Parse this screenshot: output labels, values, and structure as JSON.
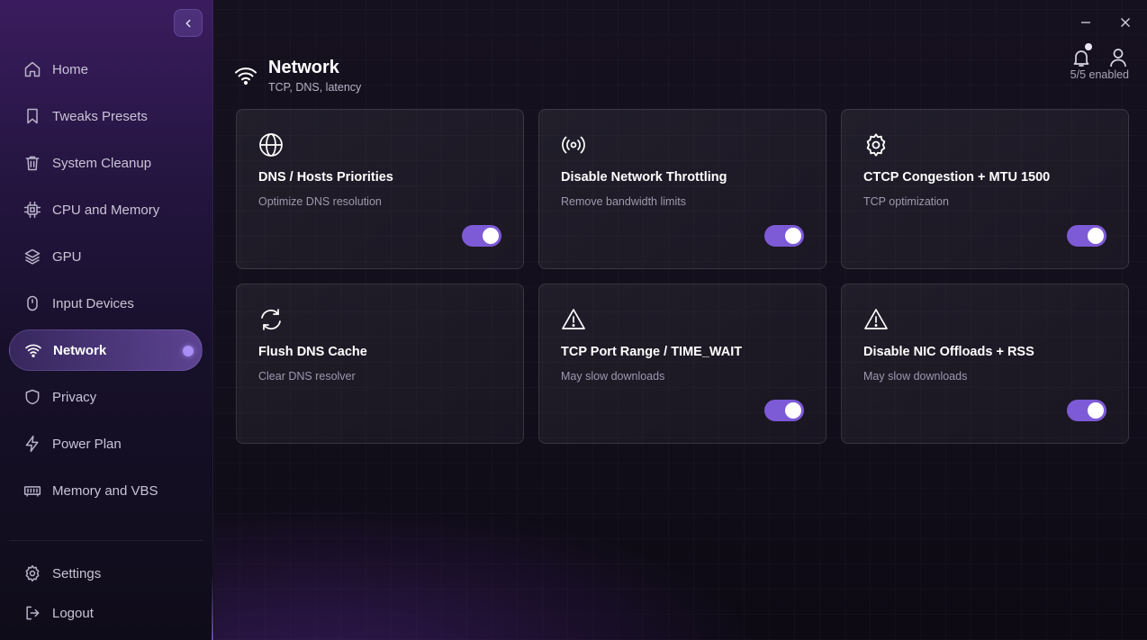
{
  "sidebar": {
    "items": [
      {
        "label": "Home",
        "icon": "home-icon"
      },
      {
        "label": "Tweaks Presets",
        "icon": "bookmark-icon"
      },
      {
        "label": "System Cleanup",
        "icon": "trash-icon"
      },
      {
        "label": "CPU and Memory",
        "icon": "cpu-icon"
      },
      {
        "label": "GPU",
        "icon": "layers-icon"
      },
      {
        "label": "Input Devices",
        "icon": "mouse-icon"
      },
      {
        "label": "Network",
        "icon": "wifi-icon",
        "active": true
      },
      {
        "label": "Privacy",
        "icon": "shield-icon"
      },
      {
        "label": "Power Plan",
        "icon": "lightning-icon"
      },
      {
        "label": "Memory and VBS",
        "icon": "memory-icon"
      }
    ],
    "footer": [
      {
        "label": "Settings",
        "icon": "gear-icon"
      },
      {
        "label": "Logout",
        "icon": "logout-icon"
      }
    ]
  },
  "header": {
    "title": "Network",
    "subtitle": "TCP, DNS, latency",
    "enabled_count": "5/5 enabled"
  },
  "cards": [
    {
      "title": "DNS / Hosts Priorities",
      "desc": "Optimize DNS resolution",
      "icon": "globe-icon",
      "toggle": true
    },
    {
      "title": "Disable Network Throttling",
      "desc": "Remove bandwidth limits",
      "icon": "broadcast-icon",
      "toggle": true
    },
    {
      "title": "CTCP Congestion + MTU 1500",
      "desc": "TCP optimization",
      "icon": "gear-icon",
      "toggle": true
    },
    {
      "title": "Flush DNS Cache",
      "desc": "Clear DNS resolver",
      "icon": "refresh-icon",
      "toggle": null
    },
    {
      "title": "TCP Port Range / TIME_WAIT",
      "desc": "May slow downloads",
      "icon": "warning-icon",
      "toggle": true
    },
    {
      "title": "Disable NIC Offloads + RSS",
      "desc": "May slow downloads",
      "icon": "warning-icon",
      "toggle": true
    }
  ],
  "colors": {
    "accent": "#7d5ad6",
    "active_dot": "#a98ef5",
    "text_primary": "#ffffff",
    "text_secondary": "#9e99ad"
  }
}
